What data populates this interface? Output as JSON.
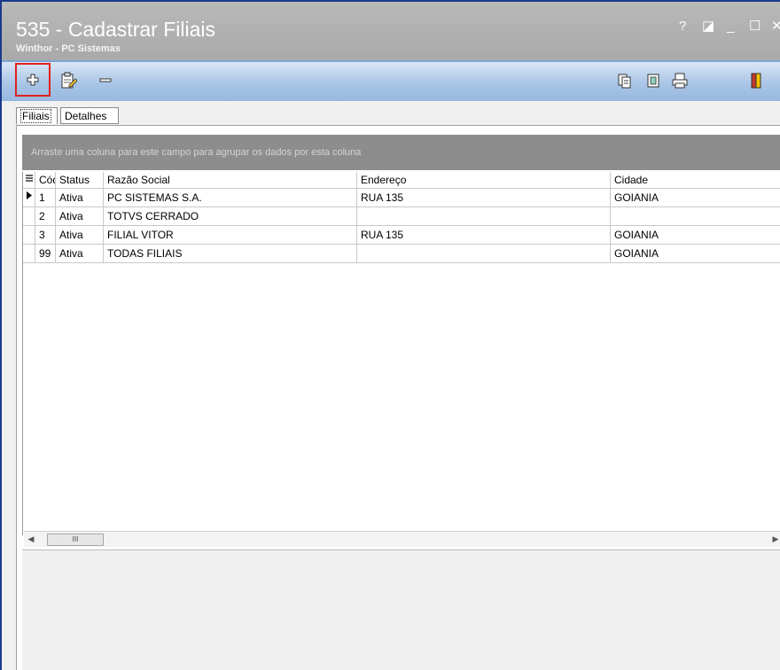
{
  "window": {
    "title": "535 - Cadastrar Filiais",
    "subtitle": "Winthor - PC Sistemas",
    "help_label": "?",
    "restore_label": "◪",
    "minimize_label": "_",
    "maximize_label": "☐",
    "close_label": "✕"
  },
  "toolbar": {
    "left_icons": [
      "add-icon",
      "edit-document-icon",
      "remove-icon"
    ],
    "right_icons": [
      "copy-icon",
      "note-icon",
      "print-icon",
      "exit-door-icon"
    ],
    "highlight_color": "#e02020"
  },
  "tabs": [
    "Filiais",
    "Detalhes"
  ],
  "grid": {
    "group_panel_text": "Arraste uma coluna para este campo para agrupar os dados por esta coluna",
    "columns": [
      "Cód",
      "Status",
      "Razão Social",
      "Endereço",
      "Cidade"
    ],
    "rows": [
      {
        "cod": "1",
        "status": "Ativa",
        "razao": "PC SISTEMAS S.A.",
        "endereco": "RUA 135",
        "cidade": "GOIANIA"
      },
      {
        "cod": "2",
        "status": "Ativa",
        "razao": "TOTVS CERRADO",
        "endereco": "",
        "cidade": ""
      },
      {
        "cod": "3",
        "status": "Ativa",
        "razao": "FILIAL VITOR",
        "endereco": "RUA 135",
        "cidade": "GOIANIA"
      },
      {
        "cod": "99",
        "status": "Ativa",
        "razao": "TODAS FILIAIS",
        "endereco": "",
        "cidade": "GOIANIA"
      }
    ],
    "scroll_thumb_label": "III"
  },
  "colors": {
    "titlebar": "#adadad",
    "toolbar": "#a9c5e6",
    "group_panel": "#8d8d8d",
    "window_border": "#1b3a8c"
  }
}
